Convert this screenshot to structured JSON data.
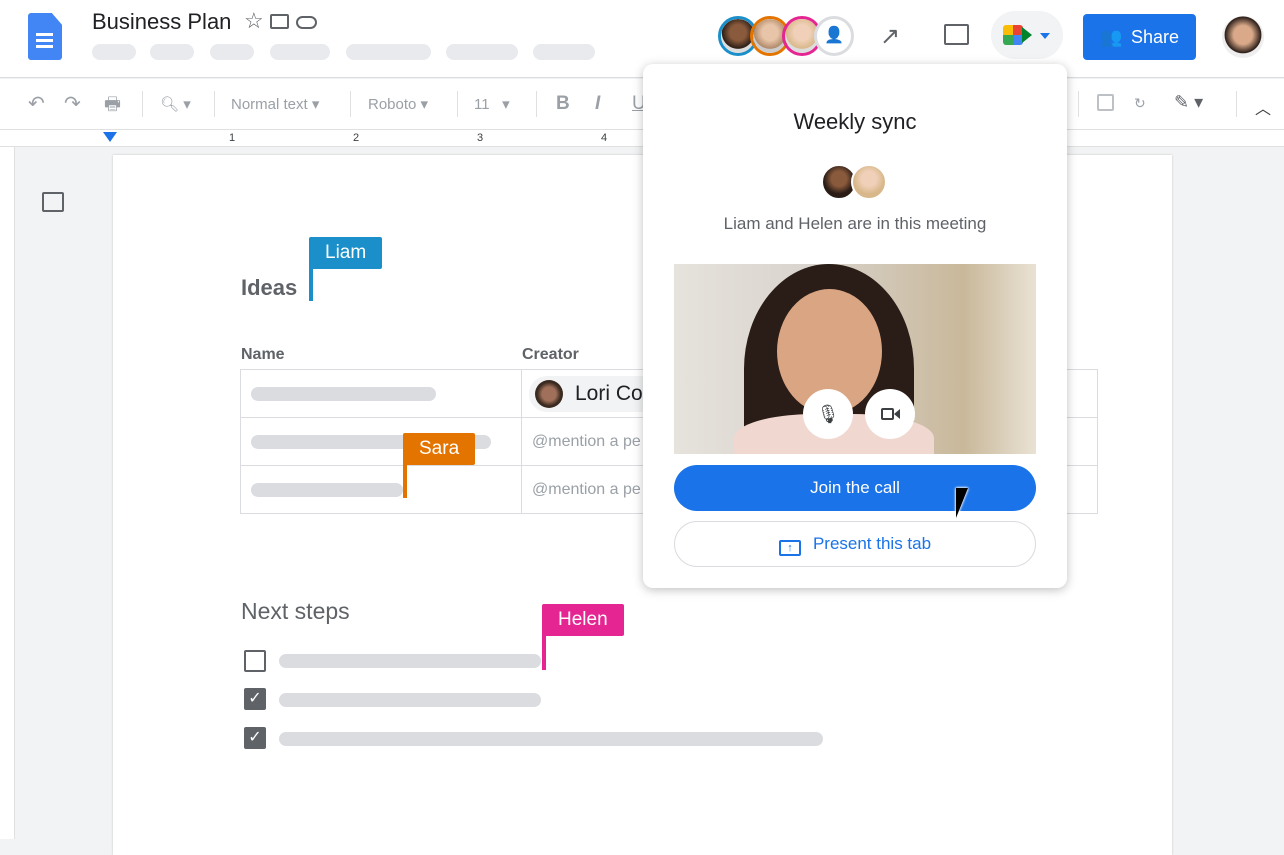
{
  "header": {
    "title": "Business Plan",
    "icons": [
      "star-icon",
      "move-to-folder-icon",
      "cloud-saved-icon"
    ],
    "collaborators": [
      {
        "ring": "#1a8fc9"
      },
      {
        "ring": "#e37400"
      },
      {
        "ring": "#e52592"
      }
    ],
    "share_label": "Share",
    "brand_color": "#1a73e8"
  },
  "toolbar": {
    "style": "Normal text",
    "font": "Roboto",
    "size": "11",
    "bold": "B",
    "italic": "I",
    "underline": "U"
  },
  "ruler": {
    "labels": [
      "1",
      "2",
      "3",
      "4"
    ]
  },
  "doc": {
    "ideas_heading": "Ideas",
    "table": {
      "headers": [
        "Name",
        "Creator"
      ],
      "rows": [
        {
          "creator": "Lori Co"
        },
        {
          "creator": "@mention a pe"
        },
        {
          "creator": "@mention a pe"
        }
      ]
    },
    "next_steps_heading": "Next steps",
    "tasks": [
      {
        "checked": false
      },
      {
        "checked": true
      },
      {
        "checked": true
      }
    ]
  },
  "cursors": [
    {
      "name": "Liam",
      "color": "#1a8fc9"
    },
    {
      "name": "Sara",
      "color": "#e37400"
    },
    {
      "name": "Helen",
      "color": "#e52592"
    }
  ],
  "popup": {
    "title": "Weekly sync",
    "subtitle": "Liam and Helen are in this meeting",
    "join_label": "Join the call",
    "present_label": "Present this tab"
  }
}
